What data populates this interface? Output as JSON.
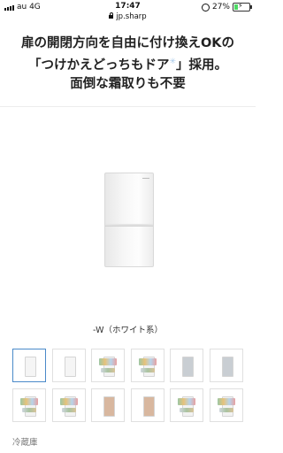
{
  "status": {
    "carrier": "au  4G",
    "time": "17:47",
    "url": "jp.sharp",
    "battery": "27%",
    "battery_level": 0.27
  },
  "headline": {
    "line1": "扉の開閉方向を自由に付け換えOKの",
    "line2_pre": "「つけかえどっちもドア",
    "line2_post": "」採用。",
    "line3": "面倒な霜取りも不要"
  },
  "product": {
    "variant_label": "-W（ホワイト系）"
  },
  "thumbnails": [
    {
      "icon": "fridge-white-closed"
    },
    {
      "icon": "fridge-white-angle"
    },
    {
      "icon": "fridge-open-contents"
    },
    {
      "icon": "fridge-open-contents"
    },
    {
      "icon": "fridge-silver"
    },
    {
      "icon": "fridge-silver-angle"
    },
    {
      "icon": "fridge-open-contents"
    },
    {
      "icon": "fridge-open-contents"
    },
    {
      "icon": "fridge-brown"
    },
    {
      "icon": "fridge-brown-angle"
    },
    {
      "icon": "fridge-open-contents"
    },
    {
      "icon": "fridge-open-contents"
    }
  ],
  "section": {
    "label": "冷蔵庫"
  }
}
